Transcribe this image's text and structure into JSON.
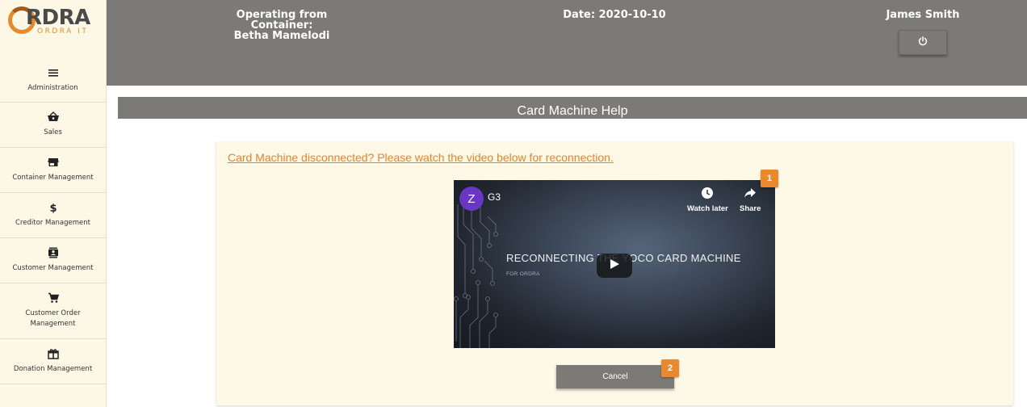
{
  "brand": {
    "name": "RDRA",
    "tagline": "ORDRA IT",
    "accent": "#e8892d"
  },
  "sidebar": {
    "items": [
      {
        "label": "Administration",
        "icon": "menu-icon"
      },
      {
        "label": "Sales",
        "icon": "basket-icon"
      },
      {
        "label": "Container Management",
        "icon": "store-icon"
      },
      {
        "label": "Creditor Management",
        "icon": "dollar-icon"
      },
      {
        "label": "Customer Management",
        "icon": "contact-card-icon"
      },
      {
        "label": "Customer Order Management",
        "icon": "cart-icon"
      },
      {
        "label": "Donation Management",
        "icon": "gift-icon"
      }
    ]
  },
  "header": {
    "container_label": "Operating from Container:",
    "container_name": "Betha Mamelodi",
    "date": "Date: 2020-10-10",
    "user": "James Smith",
    "power_icon": "power-icon"
  },
  "page": {
    "title": "Card Machine Help"
  },
  "help": {
    "link_text": "Card Machine disconnected? Please watch the video below for reconnection."
  },
  "video": {
    "channel_initial": "Z",
    "channel_name": "G3",
    "watch_later": "Watch later",
    "share": "Share",
    "title": "RECONNECTING THE YOCO CARD MACHINE",
    "subtitle": "FOR ORDRA"
  },
  "badges": {
    "video": "1",
    "cancel": "2"
  },
  "actions": {
    "cancel": "Cancel"
  }
}
